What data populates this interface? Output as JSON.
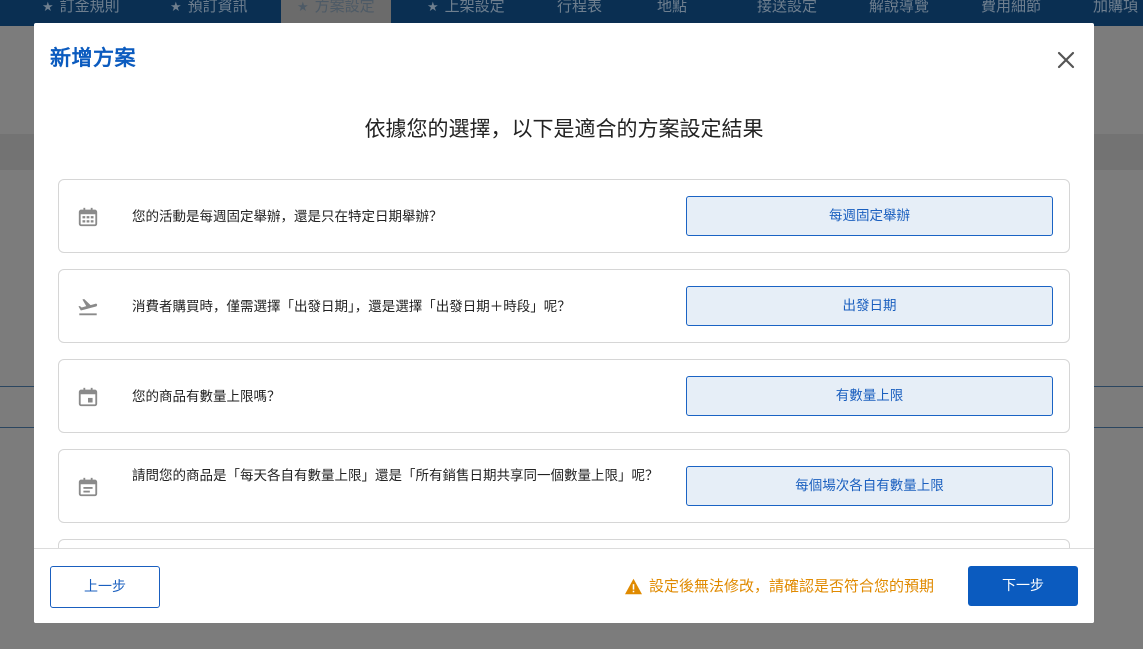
{
  "nav": {
    "tabs": [
      {
        "label": "訂金規則",
        "starred": true
      },
      {
        "label": "預訂資訊",
        "starred": true
      },
      {
        "label": "方案設定",
        "starred": true,
        "active": true
      },
      {
        "label": "上架設定",
        "starred": true
      },
      {
        "label": "行程表",
        "starred": false
      },
      {
        "label": "地點",
        "starred": false
      },
      {
        "label": "接送設定",
        "starred": false
      },
      {
        "label": "解說導覽",
        "starred": false
      },
      {
        "label": "費用細節",
        "starred": false
      },
      {
        "label": "加購項",
        "starred": false
      }
    ],
    "star_glyph": "★"
  },
  "modal": {
    "title": "新增方案",
    "subtitle": "依據您的選擇，以下是適合的方案設定結果",
    "rows": [
      {
        "icon": "calendar-grid-icon",
        "question": "您的活動是每週固定舉辦，還是只在特定日期舉辦？",
        "answer": "每週固定舉辦"
      },
      {
        "icon": "flight-takeoff-icon",
        "question": "消費者購買時，僅需選擇「出發日期」，還是選擇「出發日期＋時段」呢？",
        "answer": "出發日期"
      },
      {
        "icon": "calendar-event-icon",
        "question": "您的商品有數量上限嗎？",
        "answer": "有數量上限"
      },
      {
        "icon": "calendar-note-icon",
        "question": "請問您的商品是「每天各自有數量上限」還是「所有銷售日期共享同一個數量上限」呢？",
        "answer": "每個場次各自有數量上限"
      }
    ],
    "footer": {
      "prev_label": "上一步",
      "warning": "設定後無法修改，請確認是否符合您的預期",
      "next_label": "下一步"
    }
  },
  "colors": {
    "brand_blue": "#0b5bbf",
    "answer_bg": "#e6eef7",
    "warning": "#e08a00",
    "nav_bg": "#0a2f52"
  }
}
